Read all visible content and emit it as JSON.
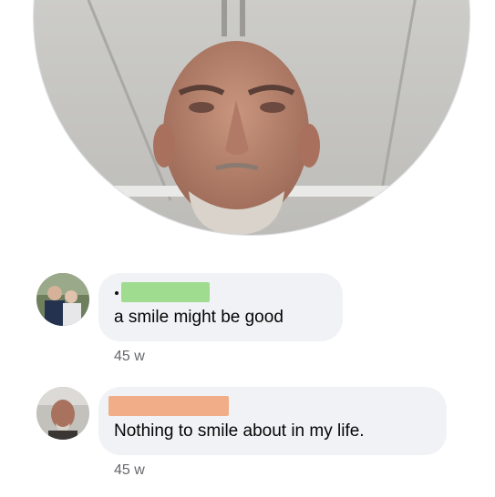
{
  "post": {
    "photo_icon": "profile-photo"
  },
  "comments": [
    {
      "avatar_icon": "couple-avatar",
      "name_redaction_color": "#9fdc8f",
      "text": "a smile might be good",
      "time": "45 w"
    },
    {
      "avatar_icon": "man-avatar",
      "name_redaction_color": "#f0ad88",
      "text": "Nothing to smile about in my life.",
      "time": "45 w"
    }
  ],
  "colors": {
    "bubble": "#f0f2f5",
    "text": "#050505",
    "meta": "#65676b"
  }
}
